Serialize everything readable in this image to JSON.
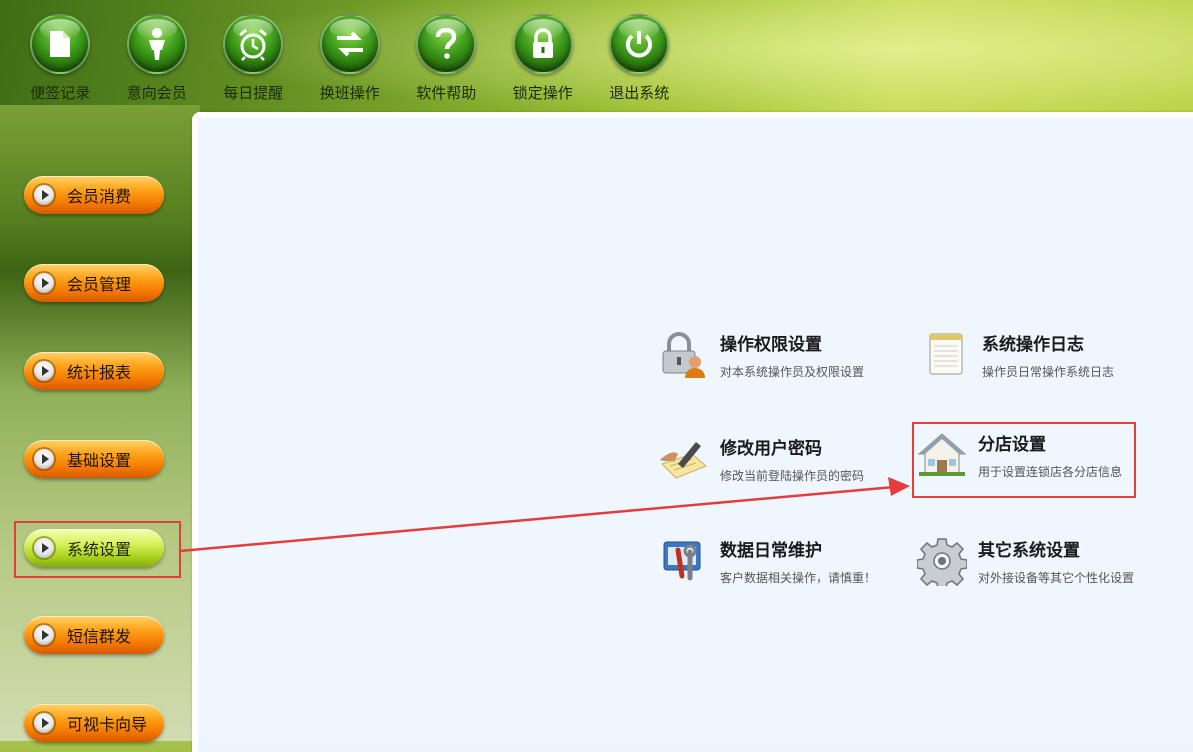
{
  "toolbar": {
    "items": [
      {
        "label": "便签记录",
        "icon": "note-icon"
      },
      {
        "label": "意向会员",
        "icon": "person-icon"
      },
      {
        "label": "每日提醒",
        "icon": "alarm-clock-icon"
      },
      {
        "label": "换班操作",
        "icon": "swap-arrows-icon"
      },
      {
        "label": "软件帮助",
        "icon": "question-icon"
      },
      {
        "label": "锁定操作",
        "icon": "lock-icon"
      },
      {
        "label": "退出系统",
        "icon": "power-icon"
      }
    ]
  },
  "sidebar": {
    "items": [
      {
        "label": "会员消费",
        "active": false
      },
      {
        "label": "会员管理",
        "active": false
      },
      {
        "label": "统计报表",
        "active": false
      },
      {
        "label": "基础设置",
        "active": false
      },
      {
        "label": "系统设置",
        "active": true
      },
      {
        "label": "短信群发",
        "active": false
      },
      {
        "label": "可视卡向导",
        "active": false
      }
    ]
  },
  "settings": {
    "items": [
      {
        "title": "操作权限设置",
        "desc": "对本系统操作员及权限设置",
        "icon": "lock-user-icon"
      },
      {
        "title": "系统操作日志",
        "desc": "操作员日常操作系统日志",
        "icon": "notepad-icon"
      },
      {
        "title": "修改用户密码",
        "desc": "修改当前登陆操作员的密码",
        "icon": "pen-paper-icon"
      },
      {
        "title": "分店设置",
        "desc": "用于设置连锁店各分店信息",
        "icon": "house-icon"
      },
      {
        "title": "数据日常维护",
        "desc": "客户数据相关操作，请慎重！",
        "icon": "tools-icon"
      },
      {
        "title": "其它系统设置",
        "desc": "对外接设备等其它个性化设置",
        "icon": "gear-icon"
      }
    ]
  },
  "colors": {
    "highlight": "#e53c3c",
    "panel": "#eff6fd",
    "button_orange": "#f57c00",
    "button_active": "#a8cf1d"
  }
}
